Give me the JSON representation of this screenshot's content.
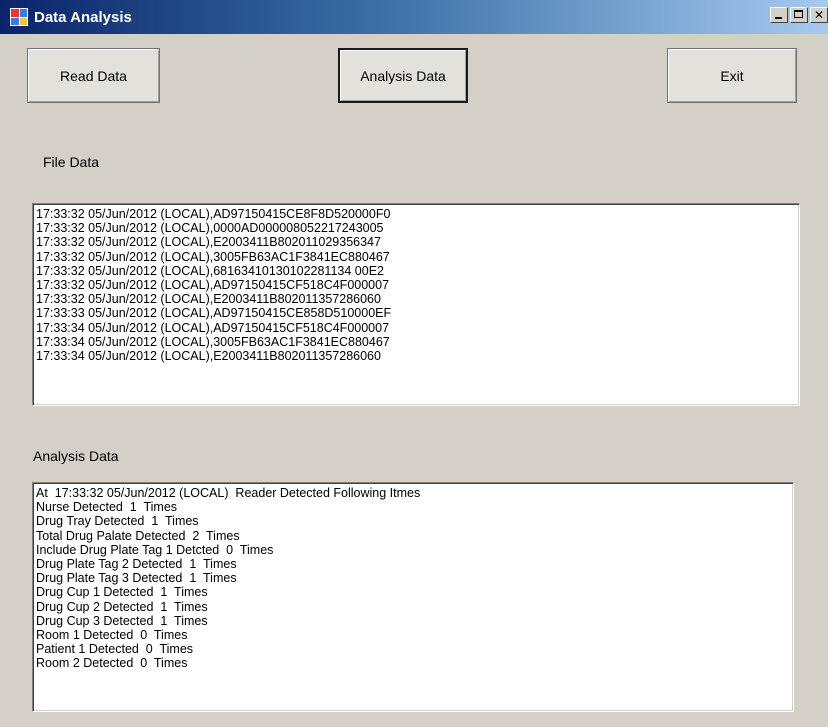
{
  "window": {
    "title": "Data Analysis"
  },
  "buttons": {
    "read": "Read Data",
    "analysis": "Analysis Data",
    "exit": "Exit"
  },
  "file_section": {
    "label": "File Data",
    "lines": [
      "17:33:32 05/Jun/2012 (LOCAL),AD97150415CE8F8D520000F0",
      "17:33:32 05/Jun/2012 (LOCAL),0000AD000008052217243005",
      "17:33:32 05/Jun/2012 (LOCAL),E2003411B802011029356347",
      "17:33:32 05/Jun/2012 (LOCAL),3005FB63AC1F3841EC880467",
      "17:33:32 05/Jun/2012 (LOCAL),68163410130102281134 00E2",
      "17:33:32 05/Jun/2012 (LOCAL),AD97150415CF518C4F000007",
      "17:33:32 05/Jun/2012 (LOCAL),E2003411B802011357286060",
      "17:33:33 05/Jun/2012 (LOCAL),AD97150415CE858D510000EF",
      "17:33:34 05/Jun/2012 (LOCAL),AD97150415CF518C4F000007",
      "17:33:34 05/Jun/2012 (LOCAL),3005FB63AC1F3841EC880467",
      "17:33:34 05/Jun/2012 (LOCAL),E2003411B802011357286060"
    ]
  },
  "analysis_section": {
    "label": "Analysis Data",
    "lines": [
      "At  17:33:32 05/Jun/2012 (LOCAL)  Reader Detected Following Itmes",
      "Nurse Detected  1  Times",
      "Drug Tray Detected  1  Times",
      "Total Drug Palate Detected  2  Times",
      "Include Drug Plate Tag 1 Detcted  0  Times",
      "Drug Plate Tag 2 Detected  1  Times",
      "Drug Plate Tag 3 Detected  1  Times",
      "Drug Cup 1 Detected  1  Times",
      "Drug Cup 2 Detected  1  Times",
      "Drug Cup 3 Detected  1  Times",
      "Room 1 Detected  0  Times",
      "Patient 1 Detected  0  Times",
      "Room 2 Detected  0  Times"
    ]
  },
  "icons": {
    "app": "app-icon",
    "minimize": "minimize-icon",
    "maximize": "maximize-icon",
    "close": "close-icon"
  }
}
